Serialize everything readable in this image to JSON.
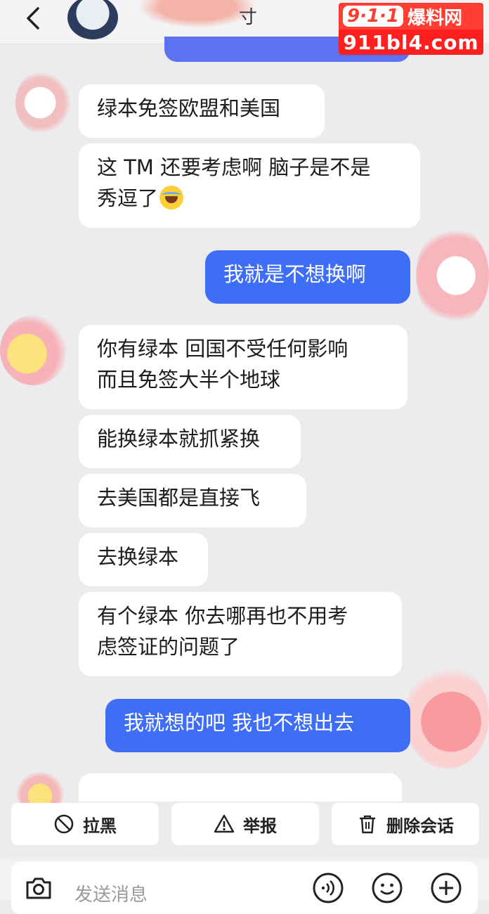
{
  "header": {
    "title_fragment": "寸"
  },
  "watermark": {
    "line1_num": "9·1·1",
    "line1_text": "爆料网",
    "line2": "911bl4.com"
  },
  "messages": [
    {
      "side": "in",
      "text": "绿本免签欧盟和美国"
    },
    {
      "side": "in",
      "line1": "这 TM 还要考虑啊 脑子是不是",
      "line2": "秀逗了",
      "emoji": "laughing-crying-emoji"
    },
    {
      "side": "out",
      "text": "我就是不想换啊"
    },
    {
      "side": "in",
      "line1": "你有绿本 回国不受任何影响",
      "line2": "而且免签大半个地球"
    },
    {
      "side": "in",
      "text": "能换绿本就抓紧换"
    },
    {
      "side": "in",
      "text": "去美国都是直接飞"
    },
    {
      "side": "in",
      "text": "去换绿本"
    },
    {
      "side": "in",
      "line1": "有个绿本 你去哪再也不用考",
      "line2": "虑签证的问题了"
    },
    {
      "side": "out",
      "text": "我就想的吧 我也不想出去"
    }
  ],
  "actions": {
    "block": "拉黑",
    "report": "举报",
    "delete": "删除会话"
  },
  "input": {
    "placeholder": "发送消息"
  },
  "colors": {
    "outgoing_bubble": "#3e6ef5",
    "incoming_bubble": "#ffffff",
    "background": "#ececef",
    "watermark_red": "#ff1f1f"
  }
}
